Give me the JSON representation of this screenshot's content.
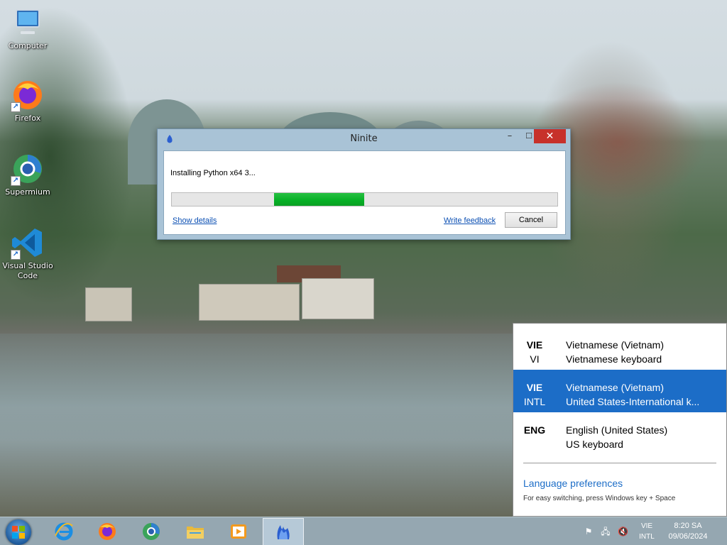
{
  "desktop": {
    "icons": [
      {
        "label": "Computer",
        "icon": "computer-icon"
      },
      {
        "label": "Firefox",
        "icon": "firefox-icon"
      },
      {
        "label": "Supermium",
        "icon": "supermium-icon"
      },
      {
        "label": "Visual Studio Code",
        "icon": "vscode-icon"
      }
    ]
  },
  "window": {
    "title": "Ninite",
    "minimize_glyph": "–",
    "maximize_glyph": "☐",
    "close_glyph": "✕",
    "status_text": "Installing Python x64 3...",
    "progress": {
      "start_fraction": 0.265,
      "end_fraction": 0.498
    },
    "show_details_label": "Show details",
    "write_feedback_label": "Write feedback",
    "cancel_label": "Cancel",
    "colors": {
      "progress_fill": "#06b025",
      "close_button": "#c7312a"
    }
  },
  "language_flyout": {
    "items": [
      {
        "code": "VIE",
        "sub_code": "VI",
        "language": "Vietnamese (Vietnam)",
        "keyboard": "Vietnamese keyboard",
        "selected": false
      },
      {
        "code": "VIE",
        "sub_code": "INTL",
        "language": "Vietnamese (Vietnam)",
        "keyboard": "United States-International k...",
        "selected": true
      },
      {
        "code": "ENG",
        "sub_code": "",
        "language": "English (United States)",
        "keyboard": "US keyboard",
        "selected": false
      }
    ],
    "preferences_label": "Language preferences",
    "hint": "For easy switching, press Windows key + Space",
    "accent_color": "#1c6dc7"
  },
  "taskbar": {
    "pinned": [
      {
        "icon": "internet-explorer-icon"
      },
      {
        "icon": "firefox-icon"
      },
      {
        "icon": "supermium-icon"
      },
      {
        "icon": "file-explorer-icon"
      },
      {
        "icon": "media-player-icon"
      },
      {
        "icon": "ninite-icon",
        "active": true
      }
    ],
    "tray": {
      "icons": [
        "action-center-flag-icon",
        "network-icon",
        "volume-muted-icon"
      ],
      "language_line1": "VIE",
      "language_line2": "INTL",
      "time": "8:20 SA",
      "date": "09/06/2024"
    }
  }
}
